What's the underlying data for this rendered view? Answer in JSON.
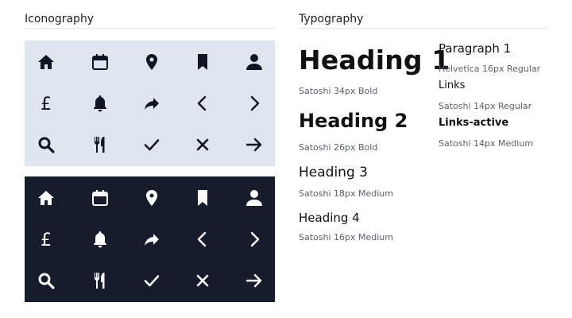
{
  "sections": {
    "iconography_title": "Iconography",
    "typography_title": "Typography"
  },
  "icon_rows": [
    [
      "home-icon",
      "calendar-icon",
      "location-pin-icon",
      "bookmark-icon",
      "user-icon"
    ],
    [
      "pound-sterling-icon",
      "bell-icon",
      "share-forward-icon",
      "chevron-left-icon",
      "chevron-right-icon"
    ],
    [
      "search-icon",
      "fork-knife-icon",
      "check-icon",
      "close-icon",
      "arrow-right-icon"
    ]
  ],
  "typography": {
    "heading1": {
      "text": "Heading 1",
      "spec": "Satoshi 34px Bold"
    },
    "heading2": {
      "text": "Heading 2",
      "spec": "Satoshi 26px Bold"
    },
    "heading3": {
      "text": "Heading 3",
      "spec": "Satoshi 18px Medium"
    },
    "heading4": {
      "text": "Heading 4",
      "spec": "Satoshi 16px Medium"
    },
    "paragraph1": {
      "text": "Paragraph 1",
      "spec": "Helvetica 16px Regular"
    },
    "links": {
      "text": "Links",
      "spec": "Satoshi 14px Regular"
    },
    "links_active": {
      "text": "Links-active",
      "spec": "Satoshi 14px Medium"
    }
  },
  "colors": {
    "light_panel_bg": "#dfe5ee",
    "dark_panel_bg": "#161c2c",
    "icon_dark": "#0f1525",
    "icon_light": "#ffffff"
  }
}
